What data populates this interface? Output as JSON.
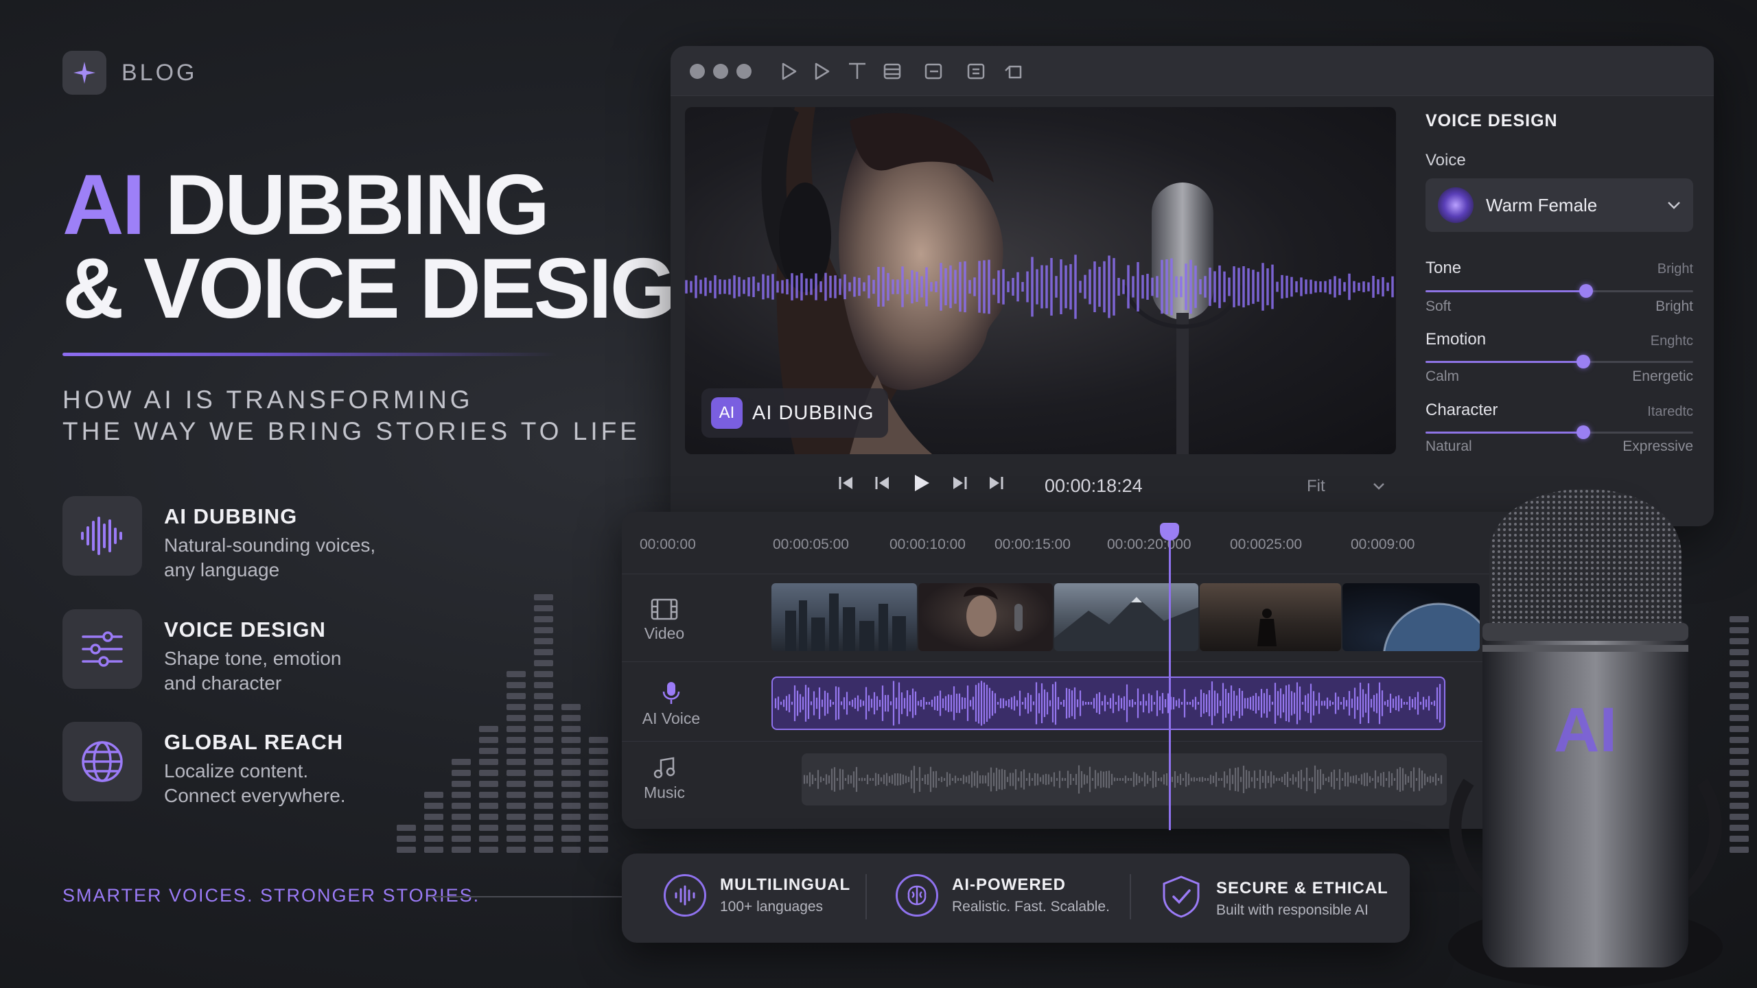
{
  "blog": {
    "label": "BLOG"
  },
  "headline": {
    "accent": "AI",
    "line1_rest": " DUBBING",
    "line2": "& VOICE DESIGN"
  },
  "subtitle": {
    "line1": "HOW AI IS TRANSFORMING",
    "line2": "THE WAY WE BRING STORIES TO LIFE"
  },
  "features": [
    {
      "title": "AI DUBBING",
      "desc": "Natural-sounding voices,\nany language",
      "icon": "waveform-icon"
    },
    {
      "title": "VOICE DESIGN",
      "desc": "Shape tone, emotion\nand character",
      "icon": "sliders-icon"
    },
    {
      "title": "GLOBAL REACH",
      "desc": "Localize content.\nConnect everywhere.",
      "icon": "globe-icon"
    }
  ],
  "tagline": "SMARTER VOICES. STRONGER STORIES.",
  "editor": {
    "toolbar_icons": [
      "play-icon",
      "play-outline-icon",
      "text-icon",
      "frame-icon",
      "edit-icon",
      "caption-icon",
      "undo-icon"
    ],
    "video_badge": {
      "icon_text": "AI",
      "label": "AI DUBBING"
    },
    "transport": {
      "timecode": "00:00:18:24",
      "fit": "Fit"
    },
    "voice_panel": {
      "title": "VOICE DESIGN",
      "voice_label": "Voice",
      "voice_value": "Warm Female",
      "sliders": [
        {
          "label": "Tone",
          "hint": "Bright",
          "min": "Soft",
          "max": "Bright",
          "value": 0.6
        },
        {
          "label": "Emotion",
          "hint": "Enghtc",
          "min": "Calm",
          "max": "Energetic",
          "value": 0.59
        },
        {
          "label": "Character",
          "hint": "Itaredtc",
          "min": "Natural",
          "max": "Expressive",
          "value": 0.59
        }
      ]
    },
    "timeline": {
      "ruler": [
        "00:00:00",
        "00:00:05:00",
        "00:00:10:00",
        "00:00:15:00",
        "00:00:20:000",
        "00:0025:00",
        "00:009:00"
      ],
      "tracks": [
        {
          "label": "Video",
          "icon": "film-icon"
        },
        {
          "label": "AI Voice",
          "icon": "microphone-icon"
        },
        {
          "label": "Music",
          "icon": "music-note-icon"
        }
      ]
    }
  },
  "bottom_bar": [
    {
      "title": "MULTILINGUAL",
      "desc": "100+ languages",
      "icon": "audio-wave-circle-icon"
    },
    {
      "title": "AI-POWERED",
      "desc": "Realistic. Fast. Scalable.",
      "icon": "brain-icon"
    },
    {
      "title": "SECURE & ETHICAL",
      "desc": "Built with responsible AI",
      "icon": "shield-check-icon"
    }
  ],
  "mic_label": "AI",
  "colors": {
    "accent": "#9b7bf7",
    "background": "#1f2126",
    "panel": "#26272c"
  }
}
